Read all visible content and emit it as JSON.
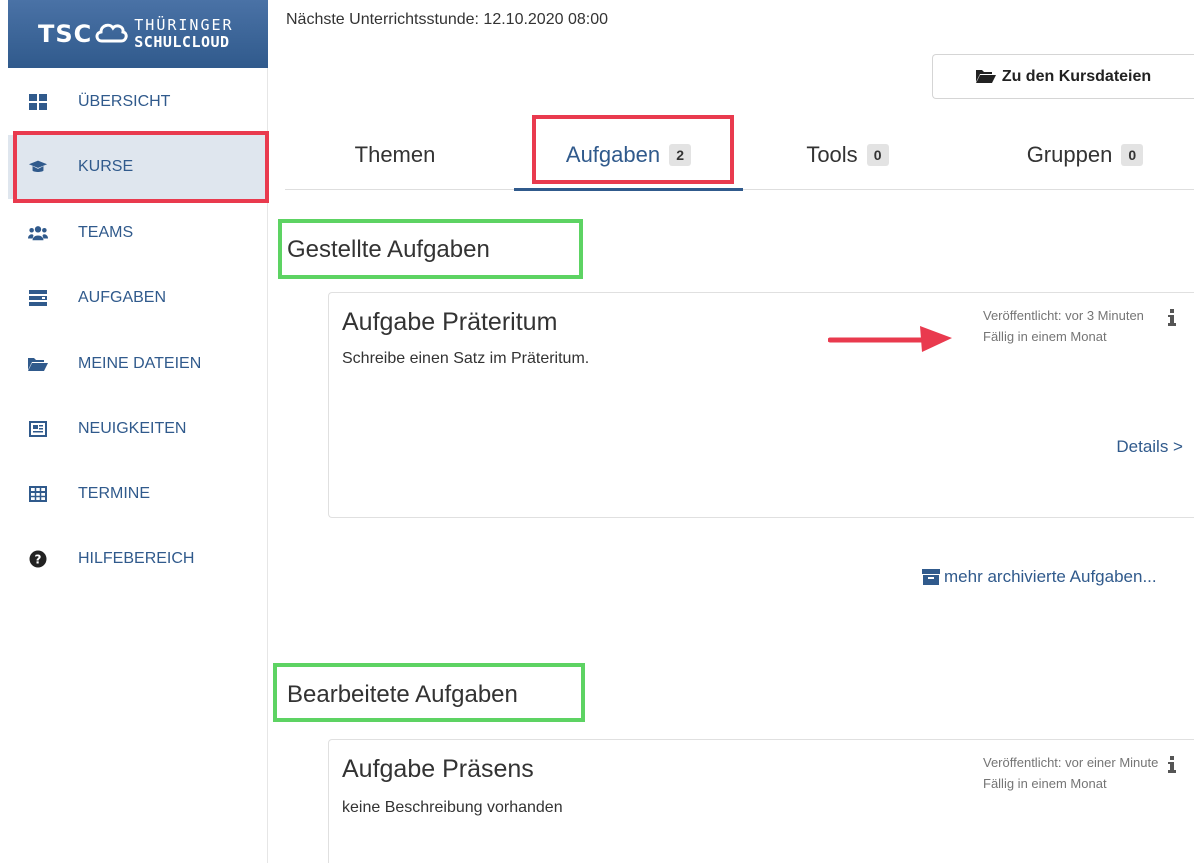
{
  "brand": {
    "short": "TSC",
    "line1": "THÜRINGER",
    "line2": "SCHULCLOUD"
  },
  "sidebar": {
    "items": [
      {
        "label": "ÜBERSICHT",
        "icon": "dashboard-icon"
      },
      {
        "label": "KURSE",
        "icon": "graduation-cap-icon",
        "active": true
      },
      {
        "label": "TEAMS",
        "icon": "users-icon"
      },
      {
        "label": "AUFGABEN",
        "icon": "tasks-icon"
      },
      {
        "label": "MEINE DATEIEN",
        "icon": "folder-open-icon"
      },
      {
        "label": "NEUIGKEITEN",
        "icon": "newspaper-icon"
      },
      {
        "label": "TERMINE",
        "icon": "calendar-table-icon"
      },
      {
        "label": "HILFEBEREICH",
        "icon": "help-circle-icon"
      }
    ]
  },
  "header": {
    "next_lesson": "Nächste Unterrichtsstunde: 12.10.2020 08:00",
    "files_button": "Zu den Kursdateien"
  },
  "tabs": [
    {
      "label": "Themen",
      "count": null
    },
    {
      "label": "Aufgaben",
      "count": "2",
      "active": true
    },
    {
      "label": "Tools",
      "count": "0"
    },
    {
      "label": "Gruppen",
      "count": "0"
    }
  ],
  "sections": {
    "assigned": {
      "title": "Gestellte Aufgaben",
      "tasks": [
        {
          "title": "Aufgabe Präteritum",
          "description": "Schreibe einen Satz im Präteritum.",
          "published": "Veröffentlicht: vor 3 Minuten",
          "due": "Fällig in einem Monat",
          "details": "Details >"
        }
      ],
      "archive_link": "mehr archivierte Aufgaben..."
    },
    "edited": {
      "title": "Bearbeitete Aufgaben",
      "tasks": [
        {
          "title": "Aufgabe Präsens",
          "description": "keine Beschreibung vorhanden",
          "published": "Veröffentlicht: vor einer Minute",
          "due": "Fällig in einem Monat"
        }
      ]
    }
  },
  "colors": {
    "brand_blue": "#305a8c",
    "highlight_red": "#e93a4e",
    "highlight_green": "#5dd363",
    "active_nav_bg": "#dfe6ee"
  }
}
